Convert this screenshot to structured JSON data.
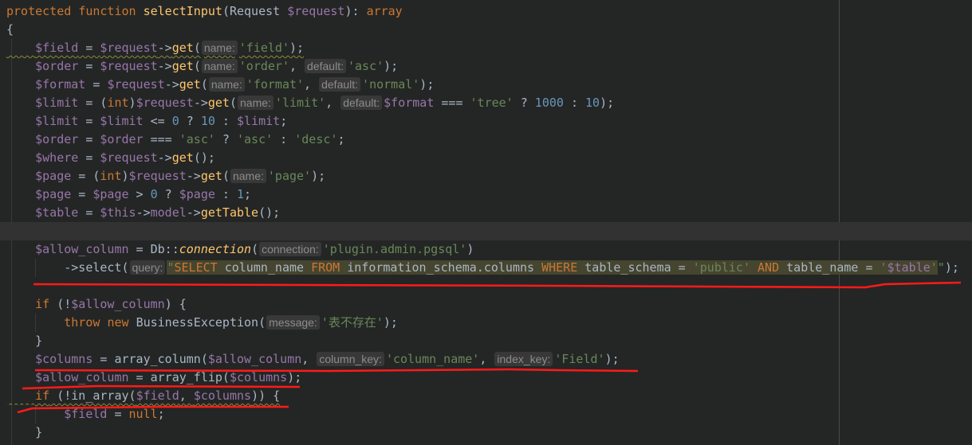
{
  "editor": {
    "language": "php",
    "colors": {
      "background": "#242625",
      "keyword": "#cc7832",
      "variable": "#9876aa",
      "function": "#ffc66d",
      "string": "#6a8759",
      "number": "#6897bb",
      "text": "#a9b7c6",
      "annotation": "#ff0000"
    },
    "current_line": 12,
    "lines": [
      {
        "tokens": [
          [
            "k",
            "protected "
          ],
          [
            "k",
            "function "
          ],
          [
            "f",
            "selectInput"
          ],
          [
            "t",
            "(Request "
          ],
          [
            "v",
            "$request"
          ],
          [
            "t",
            "): "
          ],
          [
            "k",
            "array"
          ]
        ]
      },
      {
        "tokens": [
          [
            "t",
            "{"
          ]
        ]
      },
      {
        "warn": true,
        "tokens": [
          [
            "t",
            "    "
          ],
          [
            "v",
            "$field"
          ],
          [
            "t",
            " = "
          ],
          [
            "v",
            "$request"
          ],
          [
            "t",
            "->"
          ],
          [
            "f",
            "get"
          ],
          [
            "t",
            "("
          ],
          [
            "h",
            "name:"
          ],
          [
            "s",
            "'field'"
          ],
          [
            "t",
            ");"
          ]
        ]
      },
      {
        "tokens": [
          [
            "t",
            "    "
          ],
          [
            "v",
            "$order"
          ],
          [
            "t",
            " = "
          ],
          [
            "v",
            "$request"
          ],
          [
            "t",
            "->"
          ],
          [
            "f",
            "get"
          ],
          [
            "t",
            "("
          ],
          [
            "h",
            "name:"
          ],
          [
            "s",
            "'order'"
          ],
          [
            "t",
            ", "
          ],
          [
            "h",
            "default:"
          ],
          [
            "s",
            "'asc'"
          ],
          [
            "t",
            ");"
          ]
        ]
      },
      {
        "tokens": [
          [
            "t",
            "    "
          ],
          [
            "v",
            "$format"
          ],
          [
            "t",
            " = "
          ],
          [
            "v",
            "$request"
          ],
          [
            "t",
            "->"
          ],
          [
            "f",
            "get"
          ],
          [
            "t",
            "("
          ],
          [
            "h",
            "name:"
          ],
          [
            "s",
            "'format'"
          ],
          [
            "t",
            ", "
          ],
          [
            "h",
            "default:"
          ],
          [
            "s",
            "'normal'"
          ],
          [
            "t",
            ");"
          ]
        ]
      },
      {
        "tokens": [
          [
            "t",
            "    "
          ],
          [
            "v",
            "$limit"
          ],
          [
            "t",
            " = ("
          ],
          [
            "k",
            "int"
          ],
          [
            "t",
            ")"
          ],
          [
            "v",
            "$request"
          ],
          [
            "t",
            "->"
          ],
          [
            "f",
            "get"
          ],
          [
            "t",
            "("
          ],
          [
            "h",
            "name:"
          ],
          [
            "s",
            "'limit'"
          ],
          [
            "t",
            ", "
          ],
          [
            "h",
            "default:"
          ],
          [
            "v",
            "$format"
          ],
          [
            "t",
            " === "
          ],
          [
            "s",
            "'tree'"
          ],
          [
            "t",
            " ? "
          ],
          [
            "n",
            "1000"
          ],
          [
            "t",
            " : "
          ],
          [
            "n",
            "10"
          ],
          [
            "t",
            ");"
          ]
        ]
      },
      {
        "tokens": [
          [
            "t",
            "    "
          ],
          [
            "v",
            "$limit"
          ],
          [
            "t",
            " = "
          ],
          [
            "v",
            "$limit"
          ],
          [
            "t",
            " <= "
          ],
          [
            "n",
            "0"
          ],
          [
            "t",
            " ? "
          ],
          [
            "n",
            "10"
          ],
          [
            "t",
            " : "
          ],
          [
            "v",
            "$limit"
          ],
          [
            "t",
            ";"
          ]
        ]
      },
      {
        "tokens": [
          [
            "t",
            "    "
          ],
          [
            "v",
            "$order"
          ],
          [
            "t",
            " = "
          ],
          [
            "v",
            "$order"
          ],
          [
            "t",
            " === "
          ],
          [
            "s",
            "'asc'"
          ],
          [
            "t",
            " ? "
          ],
          [
            "s",
            "'asc'"
          ],
          [
            "t",
            " : "
          ],
          [
            "s",
            "'desc'"
          ],
          [
            "t",
            ";"
          ]
        ]
      },
      {
        "tokens": [
          [
            "t",
            "    "
          ],
          [
            "v",
            "$where"
          ],
          [
            "t",
            " = "
          ],
          [
            "v",
            "$request"
          ],
          [
            "t",
            "->"
          ],
          [
            "f",
            "get"
          ],
          [
            "t",
            "();"
          ]
        ]
      },
      {
        "tokens": [
          [
            "t",
            "    "
          ],
          [
            "v",
            "$page"
          ],
          [
            "t",
            " = ("
          ],
          [
            "k",
            "int"
          ],
          [
            "t",
            ")"
          ],
          [
            "v",
            "$request"
          ],
          [
            "t",
            "->"
          ],
          [
            "f",
            "get"
          ],
          [
            "t",
            "("
          ],
          [
            "h",
            "name:"
          ],
          [
            "s",
            "'page'"
          ],
          [
            "t",
            ");"
          ]
        ]
      },
      {
        "tokens": [
          [
            "t",
            "    "
          ],
          [
            "v",
            "$page"
          ],
          [
            "t",
            " = "
          ],
          [
            "v",
            "$page"
          ],
          [
            "t",
            " > "
          ],
          [
            "n",
            "0"
          ],
          [
            "t",
            " ? "
          ],
          [
            "v",
            "$page"
          ],
          [
            "t",
            " : "
          ],
          [
            "n",
            "1"
          ],
          [
            "t",
            ";"
          ]
        ]
      },
      {
        "tokens": [
          [
            "t",
            "    "
          ],
          [
            "v",
            "$table"
          ],
          [
            "t",
            " = "
          ],
          [
            "v",
            "$this"
          ],
          [
            "t",
            "->"
          ],
          [
            "v",
            "model"
          ],
          [
            "t",
            "->"
          ],
          [
            "f",
            "getTable"
          ],
          [
            "t",
            "();"
          ]
        ]
      },
      {
        "tokens": []
      },
      {
        "tokens": [
          [
            "t",
            "    "
          ],
          [
            "v",
            "$allow_column"
          ],
          [
            "t",
            " = Db::"
          ],
          [
            "i",
            "connection"
          ],
          [
            "t",
            "("
          ],
          [
            "h",
            "connection:"
          ],
          [
            "s",
            "'plugin.admin.pgsql'"
          ],
          [
            "t",
            ")"
          ]
        ]
      },
      {
        "tokens": [
          [
            "t",
            "        ->select("
          ],
          [
            "h",
            "query:"
          ],
          [
            "qs",
            "\""
          ],
          [
            "qk",
            "SELECT "
          ],
          [
            "qt",
            "column_name "
          ],
          [
            "qk",
            "FROM "
          ],
          [
            "qt",
            "information_schema.columns "
          ],
          [
            "qk",
            "WHERE "
          ],
          [
            "qt",
            "table_schema = "
          ],
          [
            "qs",
            "'public' "
          ],
          [
            "qk",
            "AND "
          ],
          [
            "qt",
            "table_name = "
          ],
          [
            "qs",
            "'"
          ],
          [
            "qv",
            "$table"
          ],
          [
            "qs",
            "'"
          ],
          [
            "s",
            "\""
          ],
          [
            "t",
            ");"
          ]
        ]
      },
      {
        "tokens": []
      },
      {
        "tokens": [
          [
            "t",
            "    "
          ],
          [
            "k",
            "if"
          ],
          [
            "t",
            " (!"
          ],
          [
            "v",
            "$allow_column"
          ],
          [
            "t",
            ") {"
          ]
        ]
      },
      {
        "tokens": [
          [
            "t",
            "        "
          ],
          [
            "k",
            "throw "
          ],
          [
            "k",
            "new "
          ],
          [
            "t",
            "BusinessException("
          ],
          [
            "h",
            "message:"
          ],
          [
            "s",
            "'表不存在'"
          ],
          [
            "t",
            ");"
          ]
        ]
      },
      {
        "tokens": [
          [
            "t",
            "    }"
          ]
        ]
      },
      {
        "tokens": [
          [
            "t",
            "    "
          ],
          [
            "v",
            "$columns"
          ],
          [
            "t",
            " = array_column("
          ],
          [
            "v",
            "$allow_column"
          ],
          [
            "t",
            ", "
          ],
          [
            "h",
            "column_key:"
          ],
          [
            "s",
            "'column_name'"
          ],
          [
            "t",
            ", "
          ],
          [
            "h",
            "index_key:"
          ],
          [
            "s",
            "'Field'"
          ],
          [
            "t",
            ");"
          ]
        ]
      },
      {
        "tokens": [
          [
            "t",
            "    "
          ],
          [
            "v",
            "$allow_column"
          ],
          [
            "t",
            " = array_flip("
          ],
          [
            "v",
            "$columns"
          ],
          [
            "t",
            ");"
          ]
        ]
      },
      {
        "warn": true,
        "tokens": [
          [
            "t",
            "    "
          ],
          [
            "k",
            "if"
          ],
          [
            "t",
            " (!in_array("
          ],
          [
            "v",
            "$field"
          ],
          [
            "t",
            ", "
          ],
          [
            "v",
            "$columns"
          ],
          [
            "t",
            ")) {"
          ]
        ]
      },
      {
        "tokens": [
          [
            "t",
            "        "
          ],
          [
            "v",
            "$field"
          ],
          [
            "t",
            " = "
          ],
          [
            "k",
            "null"
          ],
          [
            "t",
            ";"
          ]
        ]
      },
      {
        "tokens": [
          [
            "t",
            "    }"
          ]
        ]
      }
    ]
  }
}
